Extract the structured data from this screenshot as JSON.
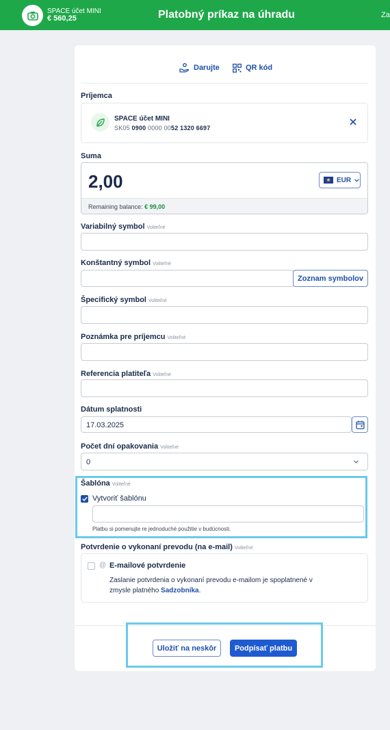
{
  "header": {
    "account_name": "SPACE účet MINI",
    "account_balance": "€ 560,25",
    "title": "Platobný príkaz na úhradu",
    "right_text": "Za"
  },
  "links": {
    "donate": "Darujte",
    "qr": "QR kód"
  },
  "recipient": {
    "label": "Príjemca",
    "name": "SPACE účet MINI",
    "iban_prefix": "SK05 ",
    "iban_bold1": "0900",
    "iban_mid": " 0000 00",
    "iban_bold2": "52 1320 6697"
  },
  "amount": {
    "label": "Suma",
    "value": "2,00",
    "currency": "EUR",
    "remaining_label": "Remaining balance: ",
    "remaining_value": "€ 99,00"
  },
  "optional_tag": "Voliteľné",
  "fields": {
    "variable_symbol": "Variabilný symbol",
    "constant_symbol": "Konštantný symbol",
    "symbol_list_button": "Zoznam symbolov",
    "specific_symbol": "Špecifický symbol",
    "note": "Poznámka pre príjemcu",
    "payer_reference": "Referencia platiteľa",
    "due_date_label": "Dátum splatnosti",
    "due_date_value": "17.03.2025",
    "repeat_days_label": "Počet dní opakovania",
    "repeat_days_value": "0"
  },
  "template": {
    "label": "Šablóna",
    "checkbox_label": "Vytvoriť šablónu",
    "checked": true,
    "hint": "Platbu si pomenujte re jednoduché použitie v budúcnosti."
  },
  "confirmation": {
    "label": "Potvrdenie o vykonaní prevodu (na e-mail)",
    "checkbox_label": "E-mailové potvrdenie",
    "text_line1": "Zaslanie potvrdenia o vykonaní prevodu e-mailom je spoplatnené v",
    "text_line2_prefix": "zmysle platného ",
    "text_link": "Sadzobníka",
    "text_suffix": "."
  },
  "actions": {
    "save_later": "Uložiť na neskôr",
    "sign": "Podpísať platbu"
  },
  "colors": {
    "brand_green": "#1ea84a",
    "primary_blue": "#1f5bd0",
    "highlight": "#6ac9ec"
  }
}
